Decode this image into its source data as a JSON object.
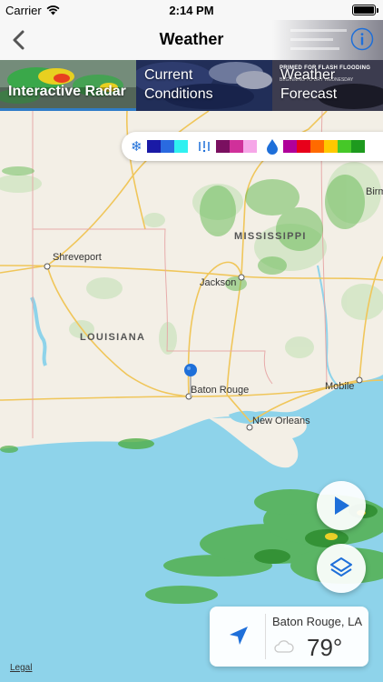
{
  "status_bar": {
    "carrier": "Carrier",
    "time": "2:14 PM"
  },
  "nav": {
    "title": "Weather",
    "back_icon": "chevron-left-icon",
    "info_icon": "info-icon"
  },
  "tabs": [
    {
      "label": "Interactive Radar",
      "active": true
    },
    {
      "label": "Current\nConditions",
      "active": false
    },
    {
      "label": "Weather\nForecast",
      "active": false,
      "headline": "PRIMED FOR FLASH FLOODING",
      "subline": "BEGINNING TO DRY WEDNESDAY"
    }
  ],
  "legend": {
    "snow_icon": "snowflake-icon",
    "mix_icon": "ice-mix-icon",
    "rain_icon": "raindrop-icon",
    "snow_colors": [
      "#1a1aa6",
      "#2a6ae0",
      "#2ff0f0"
    ],
    "mix_colors": [
      "#7a1060",
      "#d0309a",
      "#f6a6e8"
    ],
    "rain_colors": [
      "#b0009a",
      "#e8001a",
      "#ff6a00",
      "#ffc800",
      "#46c828",
      "#1e9a1e"
    ]
  },
  "map": {
    "states": [
      "MISSISSIPPI",
      "LOUISIANA"
    ],
    "cities": [
      "Shreveport",
      "Jackson",
      "Baton Rouge",
      "New Orleans",
      "Mobile",
      "Birm"
    ]
  },
  "controls": {
    "play_icon": "play-icon",
    "layers_icon": "layers-icon"
  },
  "location": {
    "city": "Baton Rouge, LA",
    "temperature": "79°",
    "arrow_icon": "location-arrow-icon",
    "condition_icon": "cloud-icon"
  },
  "legal": "Legal",
  "colors": {
    "accent": "#2f7cc7",
    "water": "#8ed3ea",
    "land": "#f5f1e8"
  }
}
